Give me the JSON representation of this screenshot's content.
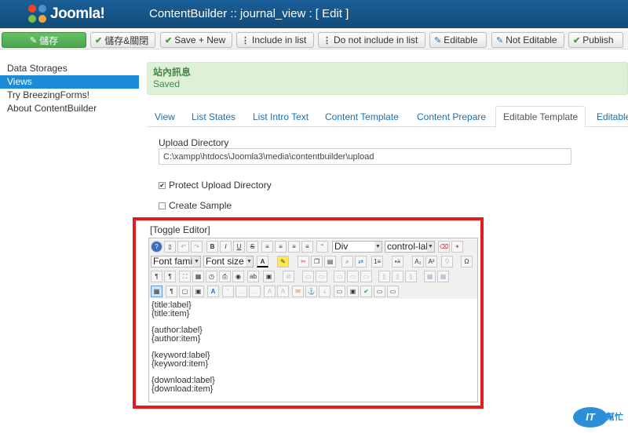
{
  "header": {
    "logo_text": "Joomla!",
    "title": "ContentBuilder :: journal_view : [ Edit ]",
    "bg_color": "#17568c"
  },
  "toolbar": {
    "buttons": [
      {
        "label": "儲存",
        "icon": "edit-icon"
      },
      {
        "label": "儲存&關閉",
        "icon": "check-icon"
      },
      {
        "label": "Save + New",
        "icon": "check-icon"
      },
      {
        "label": "Include in list",
        "icon": "list-icon"
      },
      {
        "label": "Do not include in list",
        "icon": "list-icon"
      },
      {
        "label": "Editable",
        "icon": "edit-icon"
      },
      {
        "label": "Not Editable",
        "icon": "edit-icon"
      },
      {
        "label": "Publish",
        "icon": "check-icon"
      }
    ]
  },
  "sidebar": {
    "items": [
      {
        "label": "Data Storages",
        "active": false
      },
      {
        "label": "Views",
        "active": true
      },
      {
        "label": "Try BreezingForms!",
        "active": false
      },
      {
        "label": "About ContentBuilder",
        "active": false
      }
    ]
  },
  "message": {
    "heading": "站內訊息",
    "body": "Saved",
    "bg_color": "#dff0d8"
  },
  "tabs": [
    {
      "label": "View"
    },
    {
      "label": "List States"
    },
    {
      "label": "List Intro Text"
    },
    {
      "label": "Content Template"
    },
    {
      "label": "Content Prepare"
    },
    {
      "label": "Editable Template"
    },
    {
      "label": "Editable"
    }
  ],
  "form": {
    "upload_dir_label": "Upload Directory",
    "upload_dir_value": "C:\\xampp\\htdocs\\Joomla3\\media\\contentbuilder\\upload",
    "protect_label": "Protect Upload Directory",
    "protect_checked": "✔",
    "sample_label": "Create Sample"
  },
  "editor": {
    "toggle_label": "[Toggle Editor]",
    "format_select": "Div",
    "class_select": "control-lal",
    "font_family_select": "Font famil",
    "font_size_select": "Font size",
    "content": [
      [
        "{title:label}",
        "{title:item}"
      ],
      [
        "{author:label}",
        "{author:item}"
      ],
      [
        "{keyword:label}",
        "{keyword:item}"
      ],
      [
        "{download:label}",
        "{download:item}"
      ]
    ],
    "highlight_color": "#e31b23"
  },
  "watermark": {
    "bubble": "IT",
    "text": "幫忙"
  }
}
